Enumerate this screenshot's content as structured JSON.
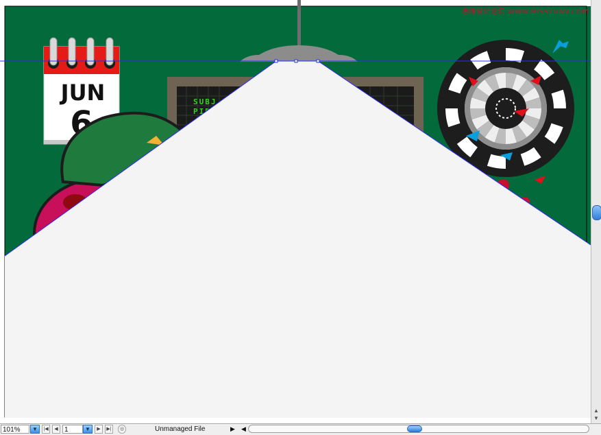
{
  "watermark": "思缘设计论坛 WWW.MISSYUAN.COM",
  "calendar": {
    "month": "JUN",
    "day": "6"
  },
  "monitor": {
    "lines": [
      "SUBJ",
      "PID"
    ]
  },
  "statusbar": {
    "zoom": "101%",
    "page": "1",
    "file_status": "Unmanaged File"
  },
  "colors": {
    "wall": "#036a3b",
    "selection": "#2b2bff",
    "paper": "#f4f4f5",
    "accent_blue": "#0a9fdc",
    "accent_red": "#e0101a"
  },
  "icons": {
    "zoom_dropdown": "chevron-down-icon",
    "first_page": "first-page-icon",
    "prev_page": "prev-page-icon",
    "page_dropdown": "chevron-down-icon",
    "next_page": "next-page-icon",
    "last_page": "last-page-icon",
    "status_menu": "triangle-right-icon",
    "scroll_left": "triangle-left-icon",
    "scroll_right": "triangle-right-icon",
    "scroll_up": "triangle-up-icon",
    "scroll_down": "triangle-down-icon"
  }
}
